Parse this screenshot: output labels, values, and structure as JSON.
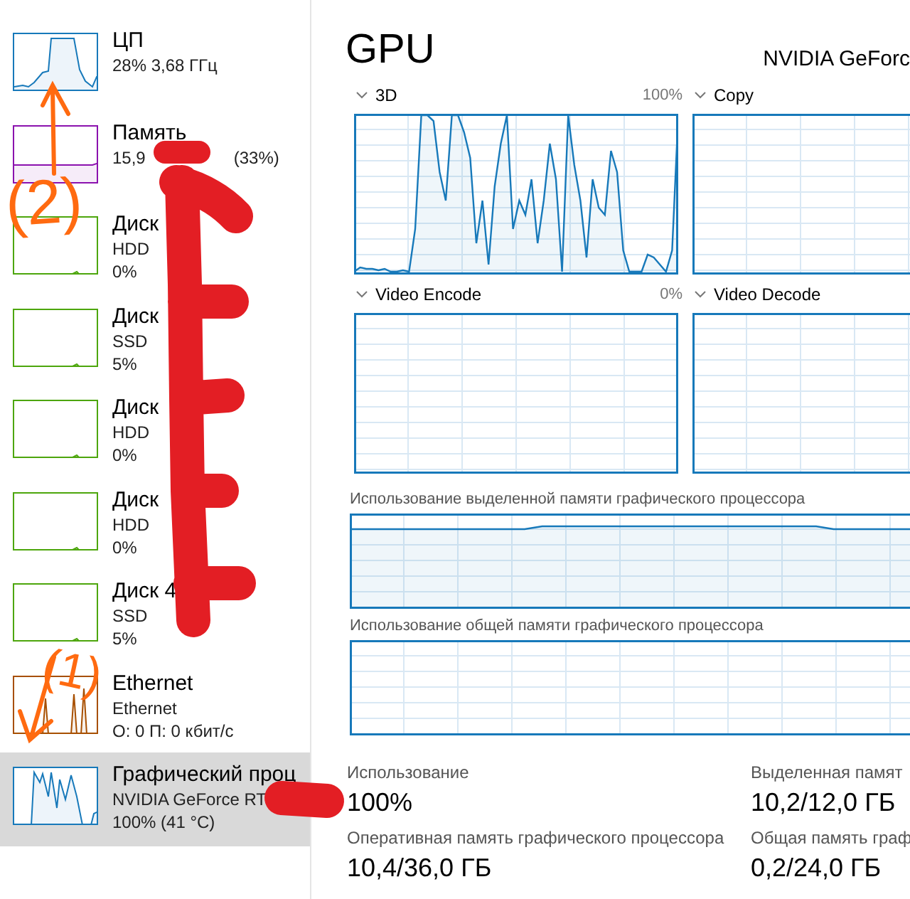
{
  "sidebar": {
    "items": [
      {
        "kind": "cpu",
        "title": "ЦП",
        "lines": [
          [
            "28%  3,68 ГГц"
          ]
        ],
        "color": "#1779ba",
        "selected": false
      },
      {
        "kind": "memory",
        "title": "Память",
        "lines": [
          [
            "15,9",
            "(33%)"
          ]
        ],
        "color": "#8b12ae",
        "selected": false
      },
      {
        "kind": "disk",
        "title": "Диск",
        "lines": [
          [
            "HDD"
          ],
          [
            "0%"
          ]
        ],
        "color": "#4da60c",
        "selected": false
      },
      {
        "kind": "disk",
        "title": "Диск",
        "lines": [
          [
            "SSD"
          ],
          [
            "5%"
          ]
        ],
        "color": "#4da60c",
        "selected": false
      },
      {
        "kind": "disk",
        "title": "Диск",
        "lines": [
          [
            "HDD"
          ],
          [
            "0%"
          ]
        ],
        "color": "#4da60c",
        "selected": false
      },
      {
        "kind": "disk",
        "title": "Диск",
        "lines": [
          [
            "HDD"
          ],
          [
            "0%"
          ]
        ],
        "color": "#4da60c",
        "selected": false
      },
      {
        "kind": "disk",
        "title": "Диск 4",
        "lines": [
          [
            "SSD"
          ],
          [
            "5%"
          ]
        ],
        "color": "#4da60c",
        "selected": false
      },
      {
        "kind": "ethernet",
        "title": "Ethernet",
        "lines": [
          [
            "Ethernet"
          ],
          [
            "О: 0 П: 0 кбит/с"
          ]
        ],
        "color": "#a74f01",
        "selected": false
      },
      {
        "kind": "gpu",
        "title": "Графический проц",
        "lines": [
          [
            "NVIDIA GeForce RT"
          ],
          [
            "100% (41 °C)"
          ]
        ],
        "color": "#1779ba",
        "selected": true
      }
    ]
  },
  "main": {
    "title": "GPU",
    "device": "NVIDIA GeForc",
    "engines": [
      {
        "label": "3D",
        "reading": "100%",
        "kind": "busy"
      },
      {
        "label": "Copy",
        "kind": "idle"
      },
      {
        "label": "Video Encode",
        "reading": "0%",
        "kind": "idle"
      },
      {
        "label": "Video Decode",
        "kind": "idle"
      }
    ],
    "memory_charts": [
      {
        "label": "Использование выделенной памяти графического процессора",
        "kind": "filled"
      },
      {
        "label": "Использование общей памяти графического процессора",
        "kind": "empty"
      }
    ],
    "stats": [
      {
        "label": "Использование",
        "value": "100%"
      },
      {
        "label": "Выделенная памят",
        "value": "10,2/12,0 ГБ"
      },
      {
        "label": "Оперативная память графического процессора",
        "value": "10,4/36,0 ГБ"
      },
      {
        "label": "Общая память граф",
        "value": "0,2/24,0 ГБ"
      }
    ]
  },
  "annotations": [
    {
      "text": "(2)"
    },
    {
      "text": "(1)"
    }
  ]
}
